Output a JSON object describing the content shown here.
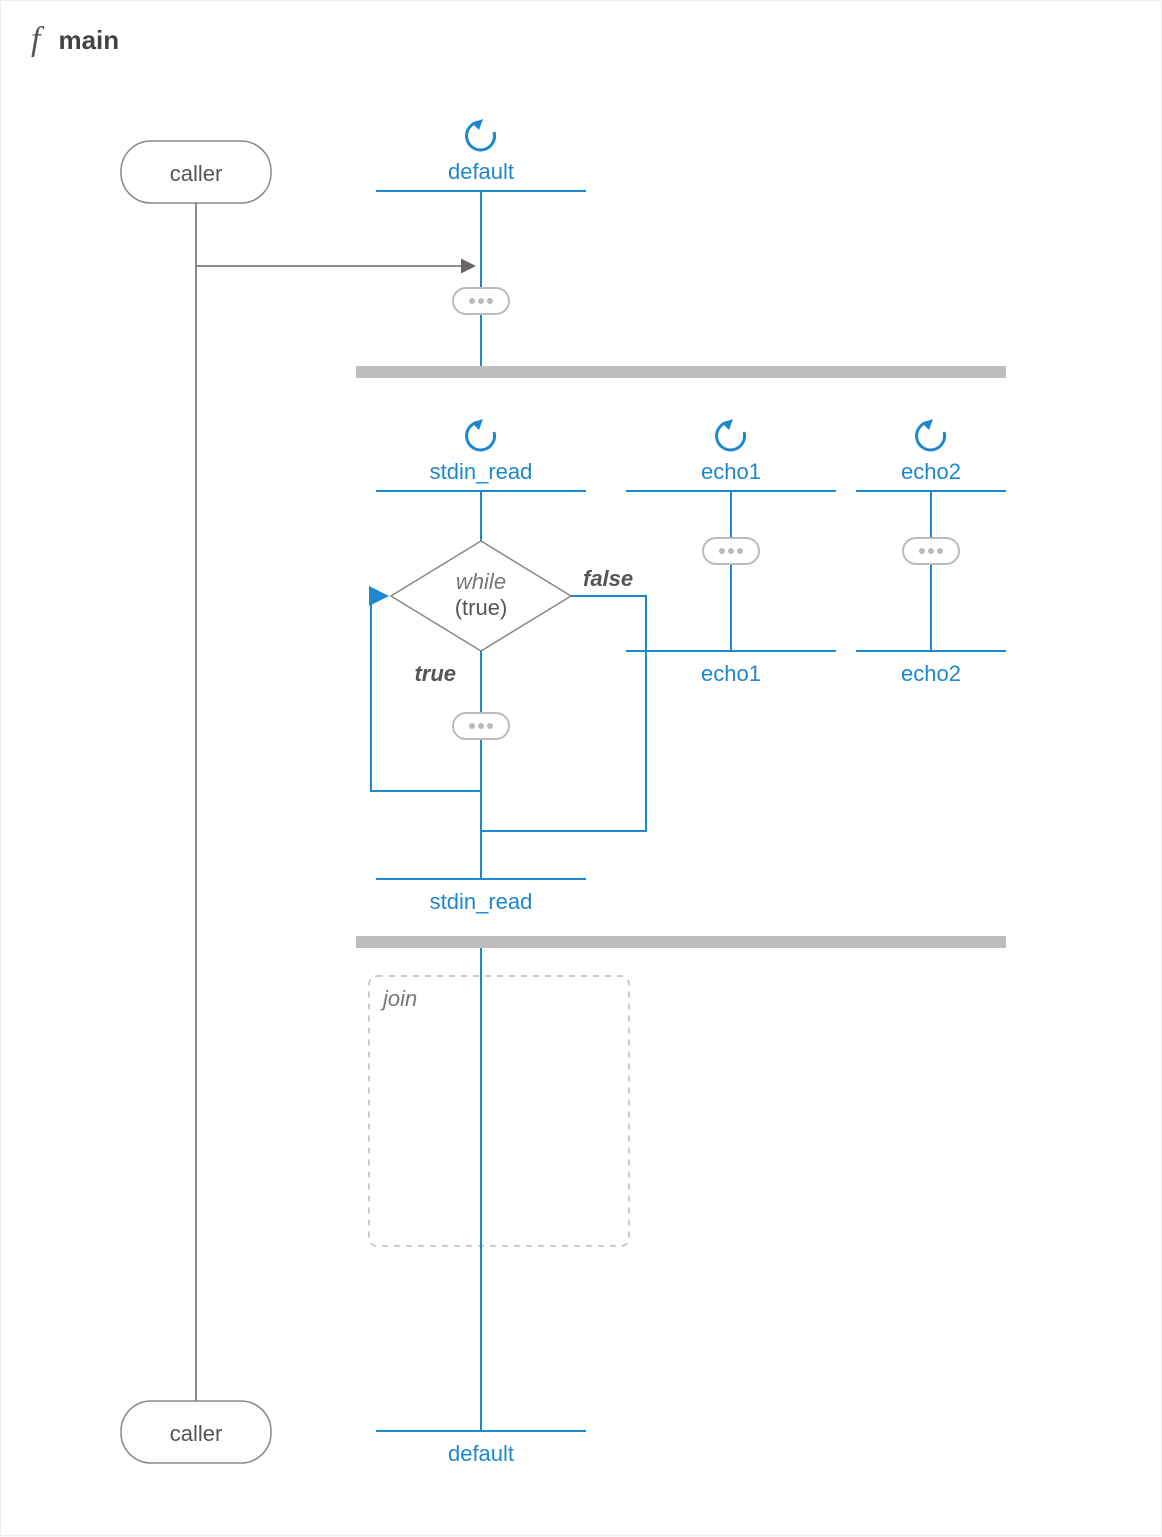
{
  "header": {
    "icon": "f",
    "title": "main"
  },
  "nodes": {
    "caller_top": "caller",
    "caller_bottom": "caller",
    "default_top": "default",
    "default_bottom": "default",
    "stdin_read_top": "stdin_read",
    "stdin_read_bottom": "stdin_read",
    "echo1_top": "echo1",
    "echo1_bottom": "echo1",
    "echo2_top": "echo2",
    "echo2_bottom": "echo2",
    "join": "join"
  },
  "decision": {
    "kind": "while",
    "condition": "(true)",
    "true_label": "true",
    "false_label": "false"
  },
  "colors": {
    "accent": "#1e88cf",
    "muted": "#888"
  }
}
